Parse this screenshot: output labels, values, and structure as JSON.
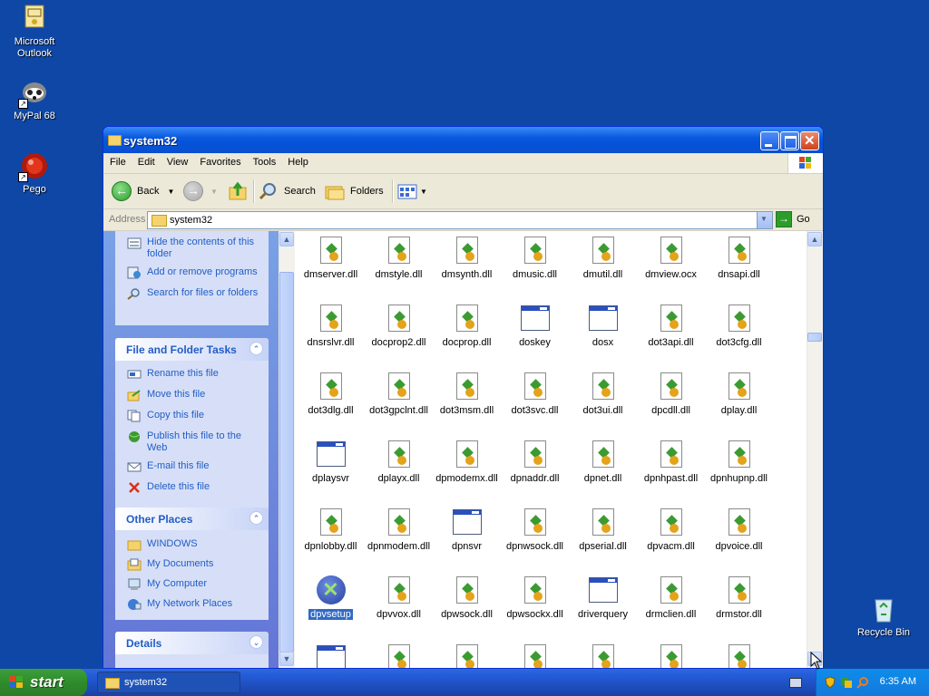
{
  "desktop": {
    "icons": [
      {
        "label": "Microsoft Outlook"
      },
      {
        "label": "MyPal 68"
      },
      {
        "label": "Pego"
      },
      {
        "label": "Recycle Bin"
      }
    ]
  },
  "window": {
    "title": "system32",
    "menu": [
      "File",
      "Edit",
      "View",
      "Favorites",
      "Tools",
      "Help"
    ],
    "toolbar": {
      "back": "Back",
      "search": "Search",
      "folders": "Folders"
    },
    "address": {
      "label": "Address",
      "value": "system32",
      "go": "Go"
    }
  },
  "tasks": {
    "system_items": [
      {
        "label": "Hide the contents of this folder",
        "icon": "folder-view-icon"
      },
      {
        "label": "Add or remove programs",
        "icon": "add-remove-icon"
      },
      {
        "label": "Search for files or folders",
        "icon": "search-icon"
      }
    ],
    "file_folder": {
      "title": "File and Folder Tasks",
      "items": [
        {
          "label": "Rename this file",
          "icon": "rename-icon"
        },
        {
          "label": "Move this file",
          "icon": "move-icon"
        },
        {
          "label": "Copy this file",
          "icon": "copy-icon"
        },
        {
          "label": "Publish this file to the Web",
          "icon": "globe-icon"
        },
        {
          "label": "E-mail this file",
          "icon": "email-icon"
        },
        {
          "label": "Delete this file",
          "icon": "delete-icon"
        }
      ]
    },
    "other_places": {
      "title": "Other Places",
      "items": [
        {
          "label": "WINDOWS",
          "icon": "folder-icon"
        },
        {
          "label": "My Documents",
          "icon": "documents-icon"
        },
        {
          "label": "My Computer",
          "icon": "computer-icon"
        },
        {
          "label": "My Network Places",
          "icon": "network-icon"
        }
      ]
    },
    "details": {
      "title": "Details"
    }
  },
  "files": [
    {
      "name": "dmserver.dll",
      "type": "dll"
    },
    {
      "name": "dmstyle.dll",
      "type": "dll"
    },
    {
      "name": "dmsynth.dll",
      "type": "dll"
    },
    {
      "name": "dmusic.dll",
      "type": "dll"
    },
    {
      "name": "dmutil.dll",
      "type": "dll"
    },
    {
      "name": "dmview.ocx",
      "type": "dll"
    },
    {
      "name": "dnsapi.dll",
      "type": "dll"
    },
    {
      "name": "dnsrslvr.dll",
      "type": "dll"
    },
    {
      "name": "docprop2.dll",
      "type": "dll"
    },
    {
      "name": "docprop.dll",
      "type": "dll"
    },
    {
      "name": "doskey",
      "type": "exe"
    },
    {
      "name": "dosx",
      "type": "exe"
    },
    {
      "name": "dot3api.dll",
      "type": "dll"
    },
    {
      "name": "dot3cfg.dll",
      "type": "dll"
    },
    {
      "name": "dot3dlg.dll",
      "type": "dll"
    },
    {
      "name": "dot3gpclnt.dll",
      "type": "dll"
    },
    {
      "name": "dot3msm.dll",
      "type": "dll"
    },
    {
      "name": "dot3svc.dll",
      "type": "dll"
    },
    {
      "name": "dot3ui.dll",
      "type": "dll"
    },
    {
      "name": "dpcdll.dll",
      "type": "dll"
    },
    {
      "name": "dplay.dll",
      "type": "dll"
    },
    {
      "name": "dplaysvr",
      "type": "exe"
    },
    {
      "name": "dplayx.dll",
      "type": "dll"
    },
    {
      "name": "dpmodemx.dll",
      "type": "dll"
    },
    {
      "name": "dpnaddr.dll",
      "type": "dll"
    },
    {
      "name": "dpnet.dll",
      "type": "dll"
    },
    {
      "name": "dpnhpast.dll",
      "type": "dll"
    },
    {
      "name": "dpnhupnp.dll",
      "type": "dll"
    },
    {
      "name": "dpnlobby.dll",
      "type": "dll"
    },
    {
      "name": "dpnmodem.dll",
      "type": "dll"
    },
    {
      "name": "dpnsvr",
      "type": "exe"
    },
    {
      "name": "dpnwsock.dll",
      "type": "dll"
    },
    {
      "name": "dpserial.dll",
      "type": "dll"
    },
    {
      "name": "dpvacm.dll",
      "type": "dll"
    },
    {
      "name": "dpvoice.dll",
      "type": "dll"
    },
    {
      "name": "dpvsetup",
      "type": "setup",
      "selected": true
    },
    {
      "name": "dpvvox.dll",
      "type": "dll"
    },
    {
      "name": "dpwsock.dll",
      "type": "dll"
    },
    {
      "name": "dpwsockx.dll",
      "type": "dll"
    },
    {
      "name": "driverquery",
      "type": "exe"
    },
    {
      "name": "drmclien.dll",
      "type": "dll"
    },
    {
      "name": "drmstor.dll",
      "type": "dll"
    },
    {
      "name": "",
      "type": "exe"
    },
    {
      "name": "",
      "type": "dll"
    },
    {
      "name": "",
      "type": "dll"
    },
    {
      "name": "",
      "type": "dll"
    },
    {
      "name": "",
      "type": "dll"
    },
    {
      "name": "",
      "type": "dll"
    },
    {
      "name": "",
      "type": "dll"
    }
  ],
  "taskbar": {
    "start": "start",
    "task_button": "system32",
    "clock": "6:35 AM"
  }
}
